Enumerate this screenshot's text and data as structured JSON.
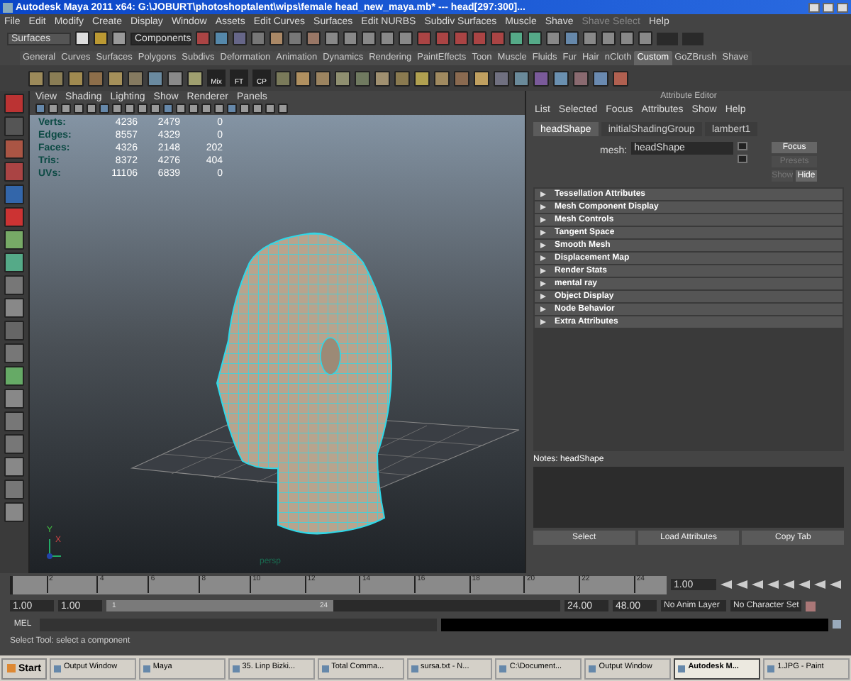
{
  "window": {
    "title": "Autodesk Maya 2011 x64: G:\\JOBURT\\photoshoptalent\\wips\\female head_new_maya.mb*  ---  head[297:300]..."
  },
  "menubar": [
    {
      "label": "File",
      "disabled": false
    },
    {
      "label": "Edit",
      "disabled": false
    },
    {
      "label": "Modify",
      "disabled": false
    },
    {
      "label": "Create",
      "disabled": false
    },
    {
      "label": "Display",
      "disabled": false
    },
    {
      "label": "Window",
      "disabled": false
    },
    {
      "label": "Assets",
      "disabled": false
    },
    {
      "label": "Edit Curves",
      "disabled": false
    },
    {
      "label": "Surfaces",
      "disabled": false
    },
    {
      "label": "Edit NURBS",
      "disabled": false
    },
    {
      "label": "Subdiv Surfaces",
      "disabled": false
    },
    {
      "label": "Muscle",
      "disabled": false
    },
    {
      "label": "Shave",
      "disabled": false
    },
    {
      "label": "Shave Select",
      "disabled": true
    },
    {
      "label": "Help",
      "disabled": false
    }
  ],
  "status_line": {
    "menu_set": "Surfaces",
    "selection_field": "Components"
  },
  "shelf": {
    "tabs": [
      {
        "label": "General",
        "selected": false
      },
      {
        "label": "Curves",
        "selected": false
      },
      {
        "label": "Surfaces",
        "selected": false
      },
      {
        "label": "Polygons",
        "selected": false
      },
      {
        "label": "Subdivs",
        "selected": false
      },
      {
        "label": "Deformation",
        "selected": false
      },
      {
        "label": "Animation",
        "selected": false
      },
      {
        "label": "Dynamics",
        "selected": false
      },
      {
        "label": "Rendering",
        "selected": false
      },
      {
        "label": "PaintEffects",
        "selected": false
      },
      {
        "label": "Toon",
        "selected": false
      },
      {
        "label": "Muscle",
        "selected": false
      },
      {
        "label": "Fluids",
        "selected": false
      },
      {
        "label": "Fur",
        "selected": false
      },
      {
        "label": "Hair",
        "selected": false
      },
      {
        "label": "nCloth",
        "selected": false
      },
      {
        "label": "Custom",
        "selected": true
      },
      {
        "label": "GoZBrush",
        "selected": false
      },
      {
        "label": "Shave",
        "selected": false
      }
    ],
    "labeled_buttons": [
      "Mix",
      "FT",
      "CP"
    ]
  },
  "viewport": {
    "menus": [
      "View",
      "Shading",
      "Lighting",
      "Show",
      "Renderer",
      "Panels"
    ],
    "hud": [
      {
        "label": "Verts:",
        "values": [
          "4236",
          "2479",
          "0"
        ]
      },
      {
        "label": "Edges:",
        "values": [
          "8557",
          "4329",
          "0"
        ]
      },
      {
        "label": "Faces:",
        "values": [
          "4326",
          "2148",
          "202"
        ]
      },
      {
        "label": "Tris:",
        "values": [
          "8372",
          "4276",
          "404"
        ]
      },
      {
        "label": "UVs:",
        "values": [
          "11106",
          "6839",
          "0"
        ]
      }
    ],
    "axis": {
      "y": "Y",
      "x": "X"
    },
    "camera": "persp"
  },
  "attribute_editor": {
    "title": "Attribute Editor",
    "menus": [
      "List",
      "Selected",
      "Focus",
      "Attributes",
      "Show",
      "Help"
    ],
    "tabs": [
      {
        "label": "headShape",
        "selected": true
      },
      {
        "label": "initialShadingGroup",
        "selected": false
      },
      {
        "label": "lambert1",
        "selected": false
      }
    ],
    "node_field": {
      "label": "mesh:",
      "value": "headShape"
    },
    "buttons": [
      {
        "label": "Focus",
        "disabled": false
      },
      {
        "label": "Presets",
        "disabled": true
      },
      {
        "label": "Show",
        "disabled": true
      },
      {
        "label": "Hide",
        "disabled": false
      }
    ],
    "sections": [
      {
        "label": "Tessellation Attributes",
        "expanded": false
      },
      {
        "label": "Mesh Component Display",
        "expanded": false
      },
      {
        "label": "Mesh Controls",
        "expanded": false
      },
      {
        "label": "Tangent Space",
        "expanded": false
      },
      {
        "label": "Smooth Mesh",
        "expanded": false
      },
      {
        "label": "Displacement Map",
        "expanded": false
      },
      {
        "label": "Render Stats",
        "expanded": false
      },
      {
        "label": "mental ray",
        "expanded": false
      },
      {
        "label": "Object Display",
        "expanded": false
      },
      {
        "label": "Node Behavior",
        "expanded": false
      },
      {
        "label": "Extra Attributes",
        "expanded": false
      }
    ],
    "notes_label": "Notes: headShape",
    "bottom_buttons": [
      "Select",
      "Load Attributes",
      "Copy Tab"
    ]
  },
  "timeline": {
    "ticks": [
      "2",
      "4",
      "6",
      "8",
      "10",
      "12",
      "14",
      "16",
      "18",
      "20",
      "22",
      "24"
    ],
    "current_frame": "1.00",
    "level": 0
  },
  "range": {
    "start": "1.00",
    "playback_start": "1.00",
    "slider_start": "1",
    "slider_end": "24",
    "level": 0.5,
    "playback_end": "24.00",
    "end": "48.00",
    "anim_layer": "No Anim Layer",
    "character_set": "No Character Set"
  },
  "command_line": {
    "label": "MEL"
  },
  "help_line": "Select Tool: select a component",
  "taskbar": {
    "start": "Start",
    "items": [
      {
        "label": "Output Window",
        "selected": false
      },
      {
        "label": "Maya",
        "selected": false
      },
      {
        "label": "35. Linp Bizki...",
        "selected": false
      },
      {
        "label": "Total Comma...",
        "selected": false
      },
      {
        "label": "sursa.txt - N...",
        "selected": false
      },
      {
        "label": "C:\\Document...",
        "selected": false
      },
      {
        "label": "Output Window",
        "selected": false
      },
      {
        "label": "Autodesk M...",
        "selected": true
      },
      {
        "label": "1.JPG - Paint",
        "selected": false
      }
    ]
  }
}
